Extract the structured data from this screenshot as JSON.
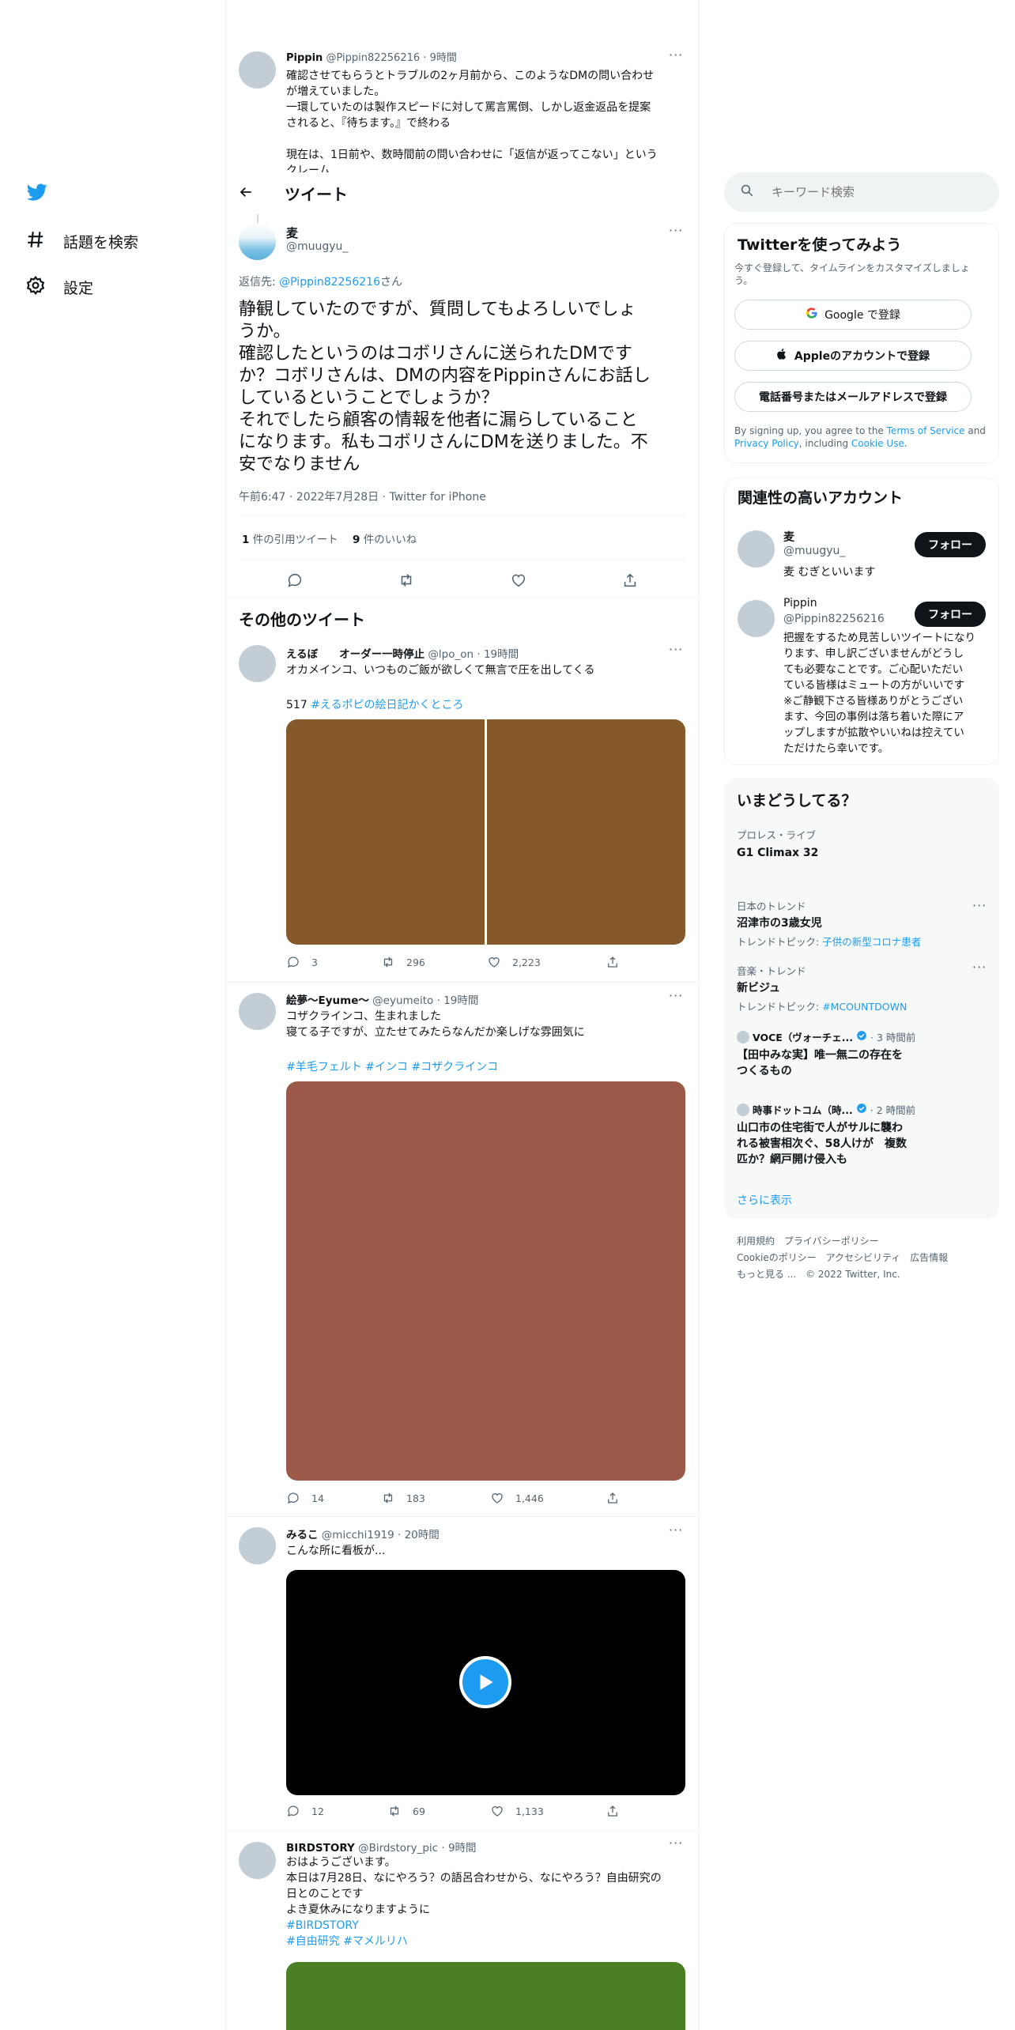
{
  "sidebar": {
    "nav": [
      {
        "label": "話題を検索",
        "icon": "hashtag-icon"
      },
      {
        "label": "設定",
        "icon": "gear-icon"
      }
    ]
  },
  "header": {
    "title": "ツイート"
  },
  "parent_tweet": {
    "name": "Pippin",
    "handle": "@Pippin82256216",
    "time": "9時間",
    "lines": [
      "確認させてもらうとトラブルの2ヶ月前から、このようなDMの問い合わせ",
      "が増えていました。",
      "一環していたのは製作スピードに対して罵言罵倒、しかし返金返品を提案",
      "されると、『待ちます。』で終わる",
      "",
      "現在は、1日前や、数時間前の問い合わせに「返信が返ってこない」という",
      "クレーム"
    ]
  },
  "main_tweet": {
    "name": "麦",
    "handle": "@muugyu_",
    "reply_prefix": "返信先:",
    "reply_to": "@Pippin82256216",
    "reply_suffix": "さん",
    "lines": [
      "静観していたのですが、質問してもよろしいでしょ",
      "うか。",
      "確認したというのはコボリさんに送られたDMです",
      "か？コボリさんは、DMの内容をPippinさんにお話し",
      "しているということでしょうか？",
      "それでしたら顧客の情報を他者に漏らしていること",
      "になります。私もコボリさんにDMを送りました。不",
      "安でなりません"
    ],
    "meta": "午前6:47 · 2022年7月28日 · Twitter for iPhone",
    "quote_count": "1",
    "quote_label": "件の引用ツイート",
    "like_count": "9",
    "like_label": "件のいいね"
  },
  "more_tweets_title": "その他のツイート",
  "tweets": [
    {
      "name": "えるぼ　　オーダー一時停止",
      "handle": "@lpo_on",
      "time": "19時間",
      "lines": [
        "オカメインコ、いつものご飯が欲しくて無言で圧を出してくる",
        ""
      ],
      "tag_prefix": "517 ",
      "tags": "#えるポピの絵日記かくところ",
      "media_color": "#86592a",
      "stats": {
        "reply": "3",
        "retweet": "296",
        "like": "2,223"
      }
    },
    {
      "name": "絵夢～Eyume～",
      "handle": "@eyumeito",
      "time": "19時間",
      "lines": [
        "コザクラインコ、生まれました",
        "寝てる子ですが、立たせてみたらなんだか楽しげな雰囲気に",
        ""
      ],
      "tags": "#羊毛フェルト #インコ #コザクラインコ",
      "media_color": "#9b5a49",
      "stats": {
        "reply": "14",
        "retweet": "183",
        "like": "1,446"
      }
    },
    {
      "name": "みるこ",
      "handle": "@micchi1919",
      "time": "20時間",
      "lines": [
        "こんな所に看板が..."
      ],
      "media_color": "#000000",
      "stats": {
        "reply": "12",
        "retweet": "69",
        "like": "1,133"
      }
    },
    {
      "name": "BIRDSTORY",
      "handle": "@Birdstory_pic",
      "time": "9時間",
      "lines": [
        "おはようございます。",
        "本日は7月28日、なにやろう？の語呂合わせから、なにやろう？自由研究の",
        "日とのことです",
        "よき夏休みになりますように"
      ],
      "tag_lines": [
        "#BIRDSTORY",
        "#自由研究 #マメルリハ"
      ],
      "media_color": "#4b7f23"
    }
  ],
  "search": {
    "placeholder": "キーワード検索"
  },
  "signup": {
    "title": "Twitterを使ってみよう",
    "sub": "今すぐ登録して、タイムラインをカスタマイズしましょう。",
    "google": "Google で登録",
    "apple": "Appleのアカウントで登録",
    "phone": "電話番号またはメールアドレスで登録",
    "legal_1": "By signing up, you agree to the ",
    "tos": "Terms of Service",
    "legal_2": " and ",
    "privacy": "Privacy Policy",
    "legal_3": ", including ",
    "cookie": "Cookie Use",
    "legal_4": "."
  },
  "related": {
    "title": "関連性の高いアカウント",
    "follow_label": "フォロー",
    "accounts": [
      {
        "name": "麦",
        "handle": "@muugyu_",
        "bio": "麦 むぎといいます"
      },
      {
        "name": "Pippin",
        "handle": "@Pippin82256216",
        "bio_lines": [
          "把握をするため見苦しいツイートになり",
          "ります、申し訳ございませんがどうし",
          "ても必要なことです。ご心配いただい",
          "ている皆様はミュートの方がいいです",
          "※ご静観下さる皆様ありがとうござい",
          "ます、今回の事例は落ち着いた際にア",
          "ップしますが拡散やいいねは控えてい",
          "ただけたら幸いです。"
        ]
      }
    ]
  },
  "whats_happening": {
    "title": "いまどうしてる？",
    "items": [
      {
        "category": "プロレス・ライブ",
        "title": "G1 Climax 32"
      },
      {
        "category": "日本のトレンド",
        "title": "沼津市の3歳女児",
        "topic_label": "トレンドトピック: ",
        "topic": "子供の新型コロナ患者"
      },
      {
        "category": "音楽・トレンド",
        "title": "新ビジュ",
        "topic_label": "トレンドトピック: ",
        "topic": "#MCOUNTDOWN"
      },
      {
        "source": "VOCE（ヴォーチェ...",
        "time": "· 3 時間前",
        "title_lines": [
          "【田中みな実】唯一無二の存在を",
          "つくるもの"
        ]
      },
      {
        "source": "時事ドットコム（時...",
        "time": "· 2 時間前",
        "title_lines": [
          "山口市の住宅街で人がサルに襲わ",
          "れる被害相次ぐ、58人けが　複数",
          "匹か？網戸開け侵入も"
        ]
      }
    ],
    "more": "さらに表示"
  },
  "footer": {
    "line1": [
      "利用規約",
      "プライバシーポリシー"
    ],
    "line2": [
      "Cookieのポリシー",
      "アクセシビリティ",
      "広告情報"
    ],
    "more": "もっと見る ...",
    "copyright": "© 2022 Twitter, Inc."
  },
  "colors": {
    "brand": "#1d9bf0",
    "text": "#0f1419",
    "muted": "#536471"
  }
}
